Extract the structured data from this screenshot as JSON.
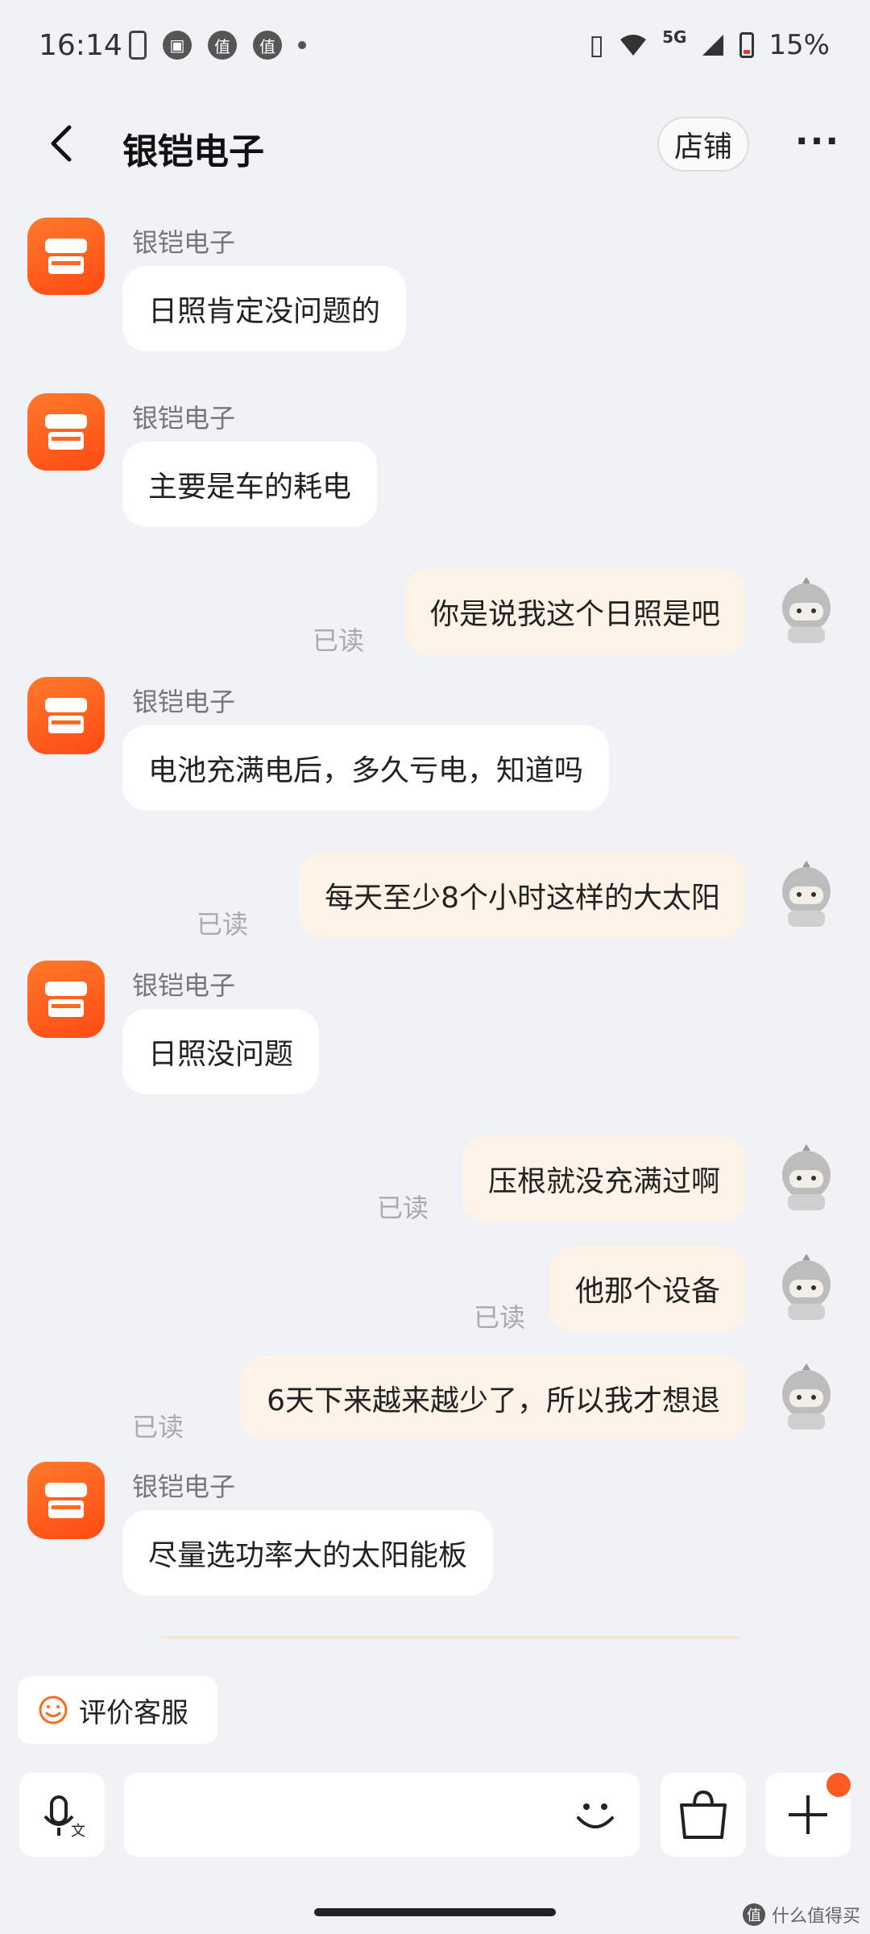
{
  "status_bar": {
    "time": "16:14",
    "icon_zhi_1": "值",
    "icon_zhi_2": "值",
    "network": "5G",
    "battery": "15%"
  },
  "header": {
    "title": "银铠电子",
    "shop_label": "店铺",
    "more_label": "···"
  },
  "messages": [
    {
      "side": "in",
      "sender": "银铠电子",
      "text": "日照肯定没问题的"
    },
    {
      "side": "in",
      "sender": "银铠电子",
      "text": "主要是车的耗电"
    },
    {
      "side": "out",
      "text": "你是说我这个日照是吧",
      "read": "已读"
    },
    {
      "side": "in",
      "sender": "银铠电子",
      "text": "电池充满电后，多久亏电，知道吗"
    },
    {
      "side": "out",
      "text": "每天至少8个小时这样的大太阳",
      "read": "已读"
    },
    {
      "side": "in",
      "sender": "银铠电子",
      "text": "日照没问题"
    },
    {
      "side": "out",
      "text": "压根就没充满过啊",
      "read": "已读"
    },
    {
      "side": "out",
      "text": "他那个设备",
      "read": "已读"
    },
    {
      "side": "out",
      "text": "6天下来越来越少了，所以我才想退",
      "read": "已读"
    },
    {
      "side": "in",
      "sender": "银铠电子",
      "text": "尽量选功率大的太阳能板"
    }
  ],
  "rate_button": {
    "label": "评价客服"
  },
  "input": {
    "placeholder": ""
  },
  "watermark": {
    "badge": "值",
    "text": "什么值得买"
  },
  "colors": {
    "background": "#f1f2f6",
    "shop_avatar": "#ff5a1f",
    "outgoing_bubble": "#fdf3e6",
    "notification_dot": "#ff5a1f"
  }
}
